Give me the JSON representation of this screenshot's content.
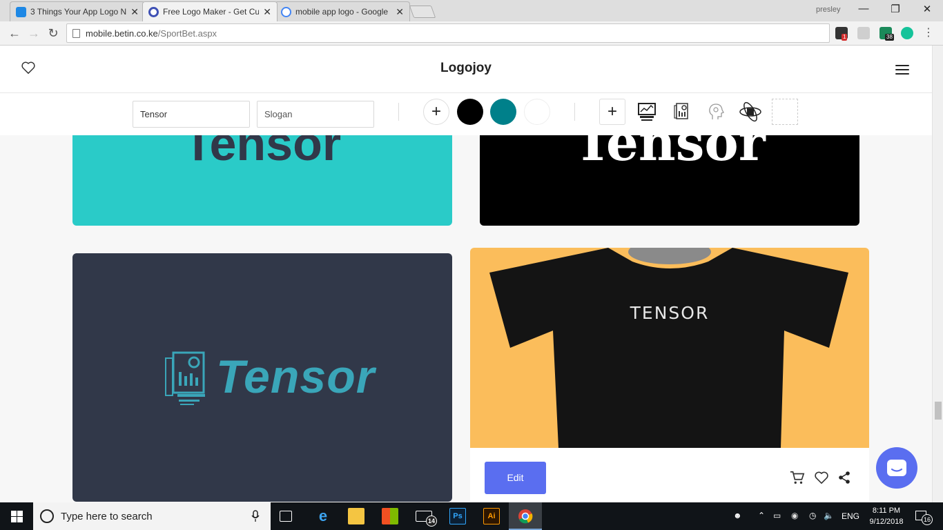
{
  "browser": {
    "tabs": [
      {
        "title": "3 Things Your App Logo N",
        "favicon_color": "#1e88e5",
        "active": false
      },
      {
        "title": "Free Logo Maker - Get Cu",
        "favicon_color": "#3f51b5",
        "active": true
      },
      {
        "title": "mobile app logo - Google",
        "favicon_color": "#4285f4",
        "active": false
      }
    ],
    "close_glyph": "✕",
    "profile": "presley",
    "url_host": "mobile.betin.co.ke",
    "url_path": "/SportBet.aspx",
    "extension_badges": {
      "first": "1",
      "second": "38"
    }
  },
  "site": {
    "brand": "Logojoy"
  },
  "editbar": {
    "name_value": "Tensor",
    "slogan_placeholder": "Slogan",
    "add_glyph": "+",
    "colors": [
      "#000000",
      "#00808a",
      "#ffffff"
    ]
  },
  "cards": {
    "teal_word": "Tensor",
    "black_word": "Tensor",
    "navy_word": "Tensor",
    "shirt_text": "TENSOR",
    "edit_label": "Edit",
    "teal_bg": "#2acbc8",
    "black_bg": "#000000",
    "navy_bg": "#313849",
    "shirt_bg": "#fbbd5b",
    "accent": "#5a6ef0"
  },
  "taskbar": {
    "search_placeholder": "Type here to search",
    "mail_badge": "14",
    "ps_label": "Ps",
    "ai_label": "Ai",
    "lang": "ENG",
    "time": "8:11 PM",
    "date": "9/12/2018",
    "notif_count": "16"
  }
}
